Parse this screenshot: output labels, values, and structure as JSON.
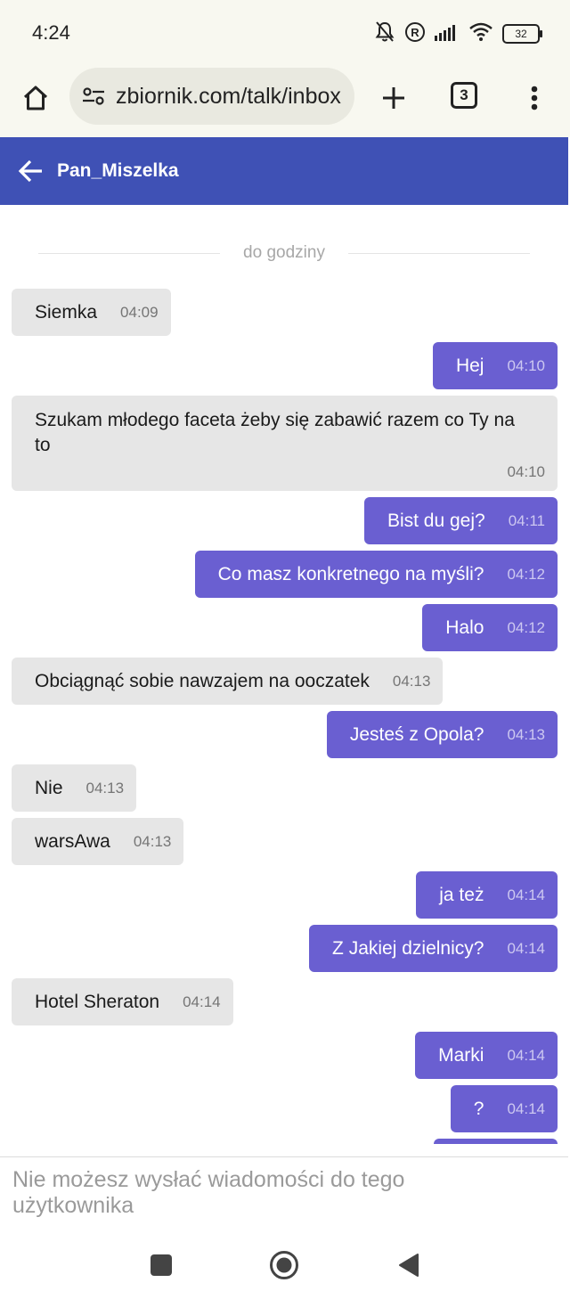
{
  "status_bar": {
    "time": "4:24",
    "battery": "32",
    "icons": [
      "bell-off-icon",
      "registered-icon",
      "signal-icon",
      "wifi-icon",
      "battery-icon"
    ]
  },
  "browser": {
    "url": "zbiornik.com/talk/inbox",
    "tab_count": "3",
    "icons": [
      "home-icon",
      "tune-icon",
      "plus-icon",
      "more-vert-icon"
    ]
  },
  "chat": {
    "title": "Pan_Miszelka",
    "divider": "do godziny",
    "messages": [
      {
        "dir": "in",
        "text": "Siemka",
        "time": "04:09"
      },
      {
        "dir": "out",
        "text": "Hej",
        "time": "04:10"
      },
      {
        "dir": "in",
        "text": "Szukam młodego faceta żeby się zabawić razem co Ty na to",
        "time": "04:10"
      },
      {
        "dir": "out",
        "text": "Bist du gej?",
        "time": "04:11"
      },
      {
        "dir": "out",
        "text": "Co masz konkretnego na myśli?",
        "time": "04:12"
      },
      {
        "dir": "out",
        "text": "Halo",
        "time": "04:12"
      },
      {
        "dir": "in",
        "text": "Obciągnąć sobie nawzajem na ooczatek",
        "time": "04:13"
      },
      {
        "dir": "out",
        "text": "Jesteś z Opola?",
        "time": "04:13"
      },
      {
        "dir": "in",
        "text": "Nie",
        "time": "04:13"
      },
      {
        "dir": "in",
        "text": "warsAwa",
        "time": "04:13"
      },
      {
        "dir": "out",
        "text": "ja też",
        "time": "04:14"
      },
      {
        "dir": "out",
        "text": "Z Jakiej dzielnicy?",
        "time": "04:14"
      },
      {
        "dir": "in",
        "text": "Hotel Sheraton",
        "time": "04:14"
      },
      {
        "dir": "out",
        "text": "Marki",
        "time": "04:14"
      },
      {
        "dir": "out",
        "text": "?",
        "time": "04:14"
      }
    ]
  },
  "footer": {
    "notice": "Nie możesz wysłać wiadomości do tego użytkownika"
  },
  "colors": {
    "header": "#3f51b5",
    "outgoing_bubble": "#6a5fd1",
    "incoming_bubble": "#e6e6e6"
  }
}
